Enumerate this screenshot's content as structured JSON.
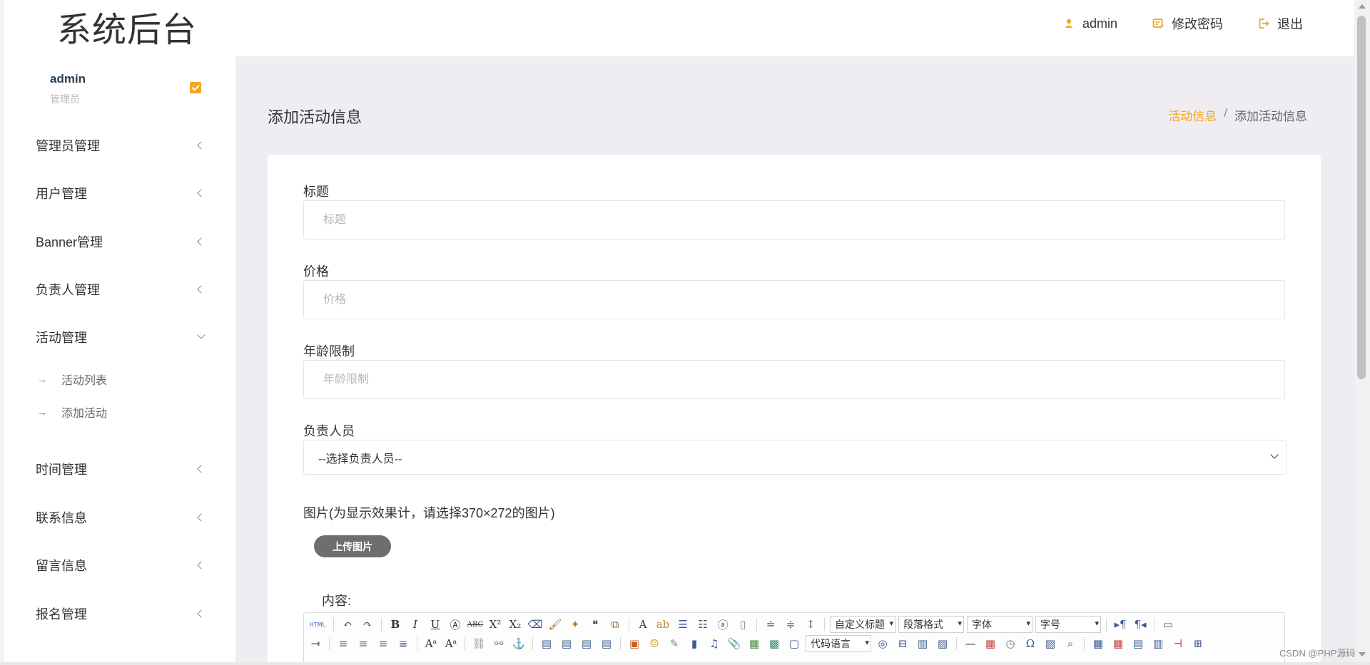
{
  "header": {
    "brand": "系统后台",
    "user": "admin",
    "change_password": "修改密码",
    "logout": "退出",
    "accent_color": "#f5a623"
  },
  "sidebar": {
    "profile": {
      "name": "admin",
      "role": "管理员"
    },
    "menu": [
      {
        "label": "管理员管理",
        "expanded": false
      },
      {
        "label": "用户管理",
        "expanded": false
      },
      {
        "label": "Banner管理",
        "expanded": false
      },
      {
        "label": "负责人管理",
        "expanded": false
      },
      {
        "label": "活动管理",
        "expanded": true,
        "children": [
          "活动列表",
          "添加活动"
        ]
      },
      {
        "label": "时间管理",
        "expanded": false
      },
      {
        "label": "联系信息",
        "expanded": false
      },
      {
        "label": "留言信息",
        "expanded": false
      },
      {
        "label": "报名管理",
        "expanded": false
      }
    ]
  },
  "main": {
    "page_title": "添加活动信息",
    "breadcrumb": {
      "parent": "活动信息",
      "separator": "/",
      "current": "添加活动信息"
    },
    "form": {
      "title": {
        "label": "标题",
        "placeholder": "标题",
        "value": ""
      },
      "price": {
        "label": "价格",
        "placeholder": "价格",
        "value": ""
      },
      "age_limit": {
        "label": "年龄限制",
        "placeholder": "年龄限制",
        "value": ""
      },
      "owner": {
        "label": "负责人员",
        "selected": "--选择负责人员--"
      },
      "image": {
        "label": "图片(为显示效果计，请选择370×272的图片)",
        "upload_button": "上传图片"
      },
      "content": {
        "label": "内容:"
      }
    },
    "editor": {
      "combo_heading": "自定义标题",
      "combo_paragraph": "段落格式",
      "combo_font_family": "字体",
      "combo_font_size": "字号",
      "combo_code_language": "代码语言",
      "html_button": "HTML"
    }
  },
  "watermark": "CSDN @PHP源码"
}
